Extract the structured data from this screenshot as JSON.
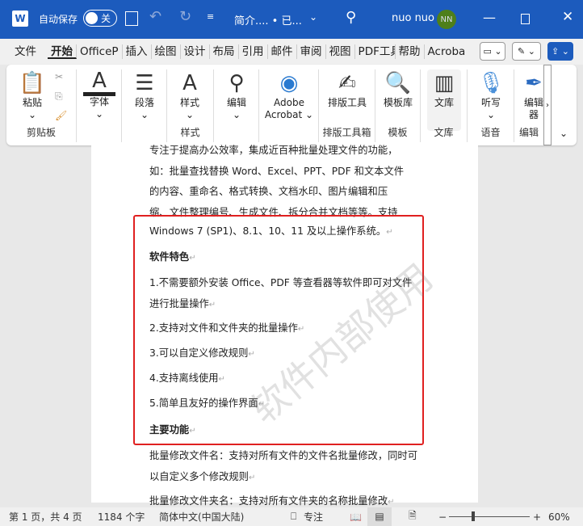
{
  "titlebar": {
    "autosave_label": "自动保存",
    "autosave_state": "关",
    "doc_title": "简介.... • 已...",
    "user": "nuo nuo",
    "avatar": "NN"
  },
  "tabs": [
    "文件",
    "开始",
    "OfficeP",
    "插入",
    "绘图",
    "设计",
    "布局",
    "引用",
    "邮件",
    "审阅",
    "视图",
    "PDF工具",
    "帮助",
    "Acroba"
  ],
  "ribbon": {
    "paste": "粘贴",
    "clipboard_group": "剪贴板",
    "font": "字体",
    "paragraph": "段落",
    "styles": "样式",
    "styles_group": "样式",
    "edit": "编辑",
    "adobe1": "Adobe",
    "adobe2": "Acrobat",
    "layout_tool": "排版工具",
    "layout_group": "排版工具箱",
    "template_lib": "模板库",
    "template_group": "模板",
    "library": "文库",
    "library_group": "文库",
    "dictate": "听写",
    "voice_group": "语音",
    "editor": "编辑器",
    "editor_group": "编辑"
  },
  "document": {
    "lines": [
      "专注于提高办公效率，集成近百种批量处理文件的功能，",
      "如：批量查找替换 Word、Excel、PPT、PDF 和文本文件",
      "的内容、重命名、格式转换、文档水印、图片编辑和压",
      "缩、文件整理编号、生成文件、拆分合并文档等等。支持",
      "Windows 7 (SP1)、8.1、10、11 及以上操作系统。"
    ],
    "features_heading": "软件特色",
    "features": [
      "1.不需要额外安装 Office、PDF 等查看器等软件即可对文件进行批量操作",
      "2.支持对文件和文件夹的批量操作",
      "3.可以自定义修改规则",
      "4.支持离线使用",
      "5.简单且友好的操作界面"
    ],
    "main_heading": "主要功能",
    "main1": "批量修改文件名：支持对所有文件的文件名批量修改，同时可以自定义多个修改规则",
    "main2": "批量修改文件夹名：支持对所有文件夹的名称批量修改",
    "watermark": "软件内部使用"
  },
  "status": {
    "page": "第 1 页，共 4 页",
    "words": "1184 个字",
    "language": "简体中文(中国大陆)",
    "focus": "专注",
    "zoom": "60%",
    "zoom_percent": 60
  }
}
